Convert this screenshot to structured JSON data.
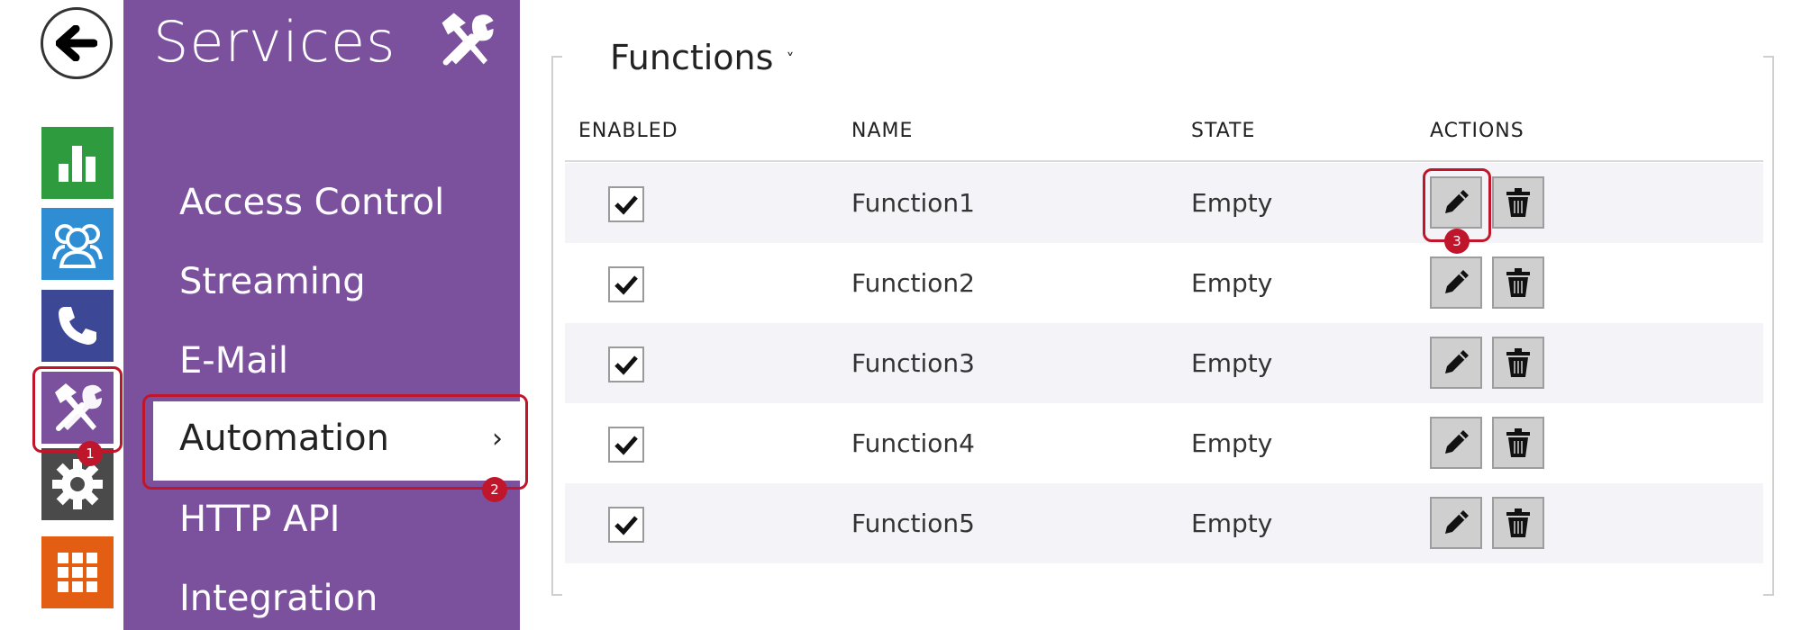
{
  "rail": {
    "items": [
      {
        "name": "status",
        "icon": "bar-chart-icon",
        "color": "#2e9b3e"
      },
      {
        "name": "directory",
        "icon": "users-icon",
        "color": "#2f8dd3"
      },
      {
        "name": "phone",
        "icon": "phone-icon",
        "color": "#3c4896"
      },
      {
        "name": "services",
        "icon": "tools-icon",
        "color": "#7b519e",
        "active": true
      },
      {
        "name": "hardware",
        "icon": "gear-icon",
        "color": "#4a4a4a"
      },
      {
        "name": "apps",
        "icon": "grid-icon",
        "color": "#e35e12"
      }
    ]
  },
  "panel": {
    "title": "Services",
    "icon": "tools-icon",
    "menu": [
      {
        "label": "Access Control"
      },
      {
        "label": "Streaming"
      },
      {
        "label": "E-Mail"
      },
      {
        "label": "Automation",
        "active": true
      },
      {
        "label": "HTTP API"
      },
      {
        "label": "Integration"
      }
    ]
  },
  "main": {
    "section_title": "Functions",
    "columns": {
      "enabled": "ENABLED",
      "name": "NAME",
      "state": "STATE",
      "actions": "ACTIONS"
    },
    "rows": [
      {
        "enabled": true,
        "name": "Function1",
        "state": "Empty"
      },
      {
        "enabled": true,
        "name": "Function2",
        "state": "Empty"
      },
      {
        "enabled": true,
        "name": "Function3",
        "state": "Empty"
      },
      {
        "enabled": true,
        "name": "Function4",
        "state": "Empty"
      },
      {
        "enabled": true,
        "name": "Function5",
        "state": "Empty"
      }
    ]
  },
  "annotations": {
    "badge1": "1",
    "badge2": "2",
    "badge3": "3"
  },
  "colors": {
    "accent": "#7b519e",
    "highlight": "#c0162b"
  }
}
